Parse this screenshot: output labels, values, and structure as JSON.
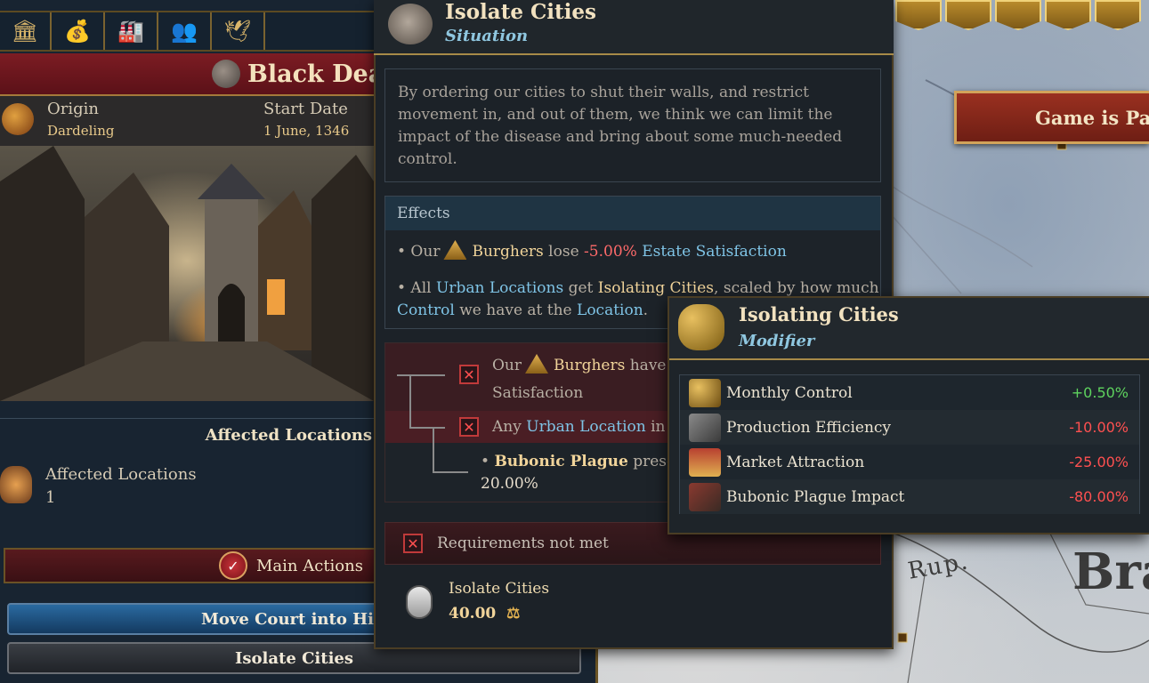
{
  "map": {
    "paused_banner": "Game is Pau",
    "labels": [
      "Rup.",
      "Bra"
    ]
  },
  "left_panel": {
    "top_tab_icons": [
      "building-icon",
      "coins-bag-icon",
      "factory-icon",
      "people-icon",
      "dove-icon"
    ],
    "title": "Black Deat",
    "origin_label": "Origin",
    "origin_value": "Dardeling",
    "start_date_label": "Start Date",
    "start_date_value": "1 June, 1346",
    "affected_header": "Affected Locations",
    "affected_label": "Affected Locations",
    "affected_value": "1",
    "main_actions": "Main Actions",
    "buttons": {
      "move_court": "Move Court into Hidin",
      "isolate_cities": "Isolate Cities"
    }
  },
  "tooltip": {
    "title": "Isolate Cities",
    "subtitle": "Situation",
    "description": "By ordering our cities to shut their walls, and restrict movement in, and out of them, we think we can limit the impact of the disease and bring about some much-needed control.",
    "effects_header": "Effects",
    "effect1": {
      "prefix": "• Our",
      "estate": "Burghers",
      "verb": "lose",
      "value": "-5.00%",
      "target": "Estate Satisfaction"
    },
    "effect2": {
      "prefix": "• All",
      "locations": "Urban Locations",
      "verb": "get",
      "modifier": "Isolating Cities",
      "rest1": ", scaled by how much",
      "control": "Control",
      "rest2": "we have at the",
      "location": "Location",
      "end": "."
    },
    "req1": {
      "prefix": "Our",
      "estate": "Burghers",
      "rest": "have",
      "line2": "Satisfaction"
    },
    "req2": {
      "prefix": "Any",
      "location": "Urban Location",
      "rest": "in"
    },
    "req3": {
      "bullet": "•",
      "name": "Bubonic Plague",
      "rest": "presen",
      "value": "20.00%"
    },
    "requirements_not_met": "Requirements not met",
    "cost_name": "Isolate Cities",
    "cost_value": "40.00"
  },
  "modifier": {
    "title": "Isolating Cities",
    "subtitle": "Modifier",
    "rows": [
      {
        "label": "Monthly Control",
        "value": "+0.50%",
        "sign": "pos",
        "icon": "key-icon"
      },
      {
        "label": "Production Efficiency",
        "value": "-10.00%",
        "sign": "neg",
        "icon": "anvil-icon"
      },
      {
        "label": "Market Attraction",
        "value": "-25.00%",
        "sign": "neg",
        "icon": "market-stall-icon"
      },
      {
        "label": "Bubonic Plague Impact",
        "value": "-80.00%",
        "sign": "neg",
        "icon": "plague-cart-icon"
      }
    ]
  },
  "colors": {
    "accent_gold": "#f1d49a",
    "link_blue": "#7fc4e6",
    "negative_red": "#ff5050",
    "positive_green": "#5ed35e"
  }
}
